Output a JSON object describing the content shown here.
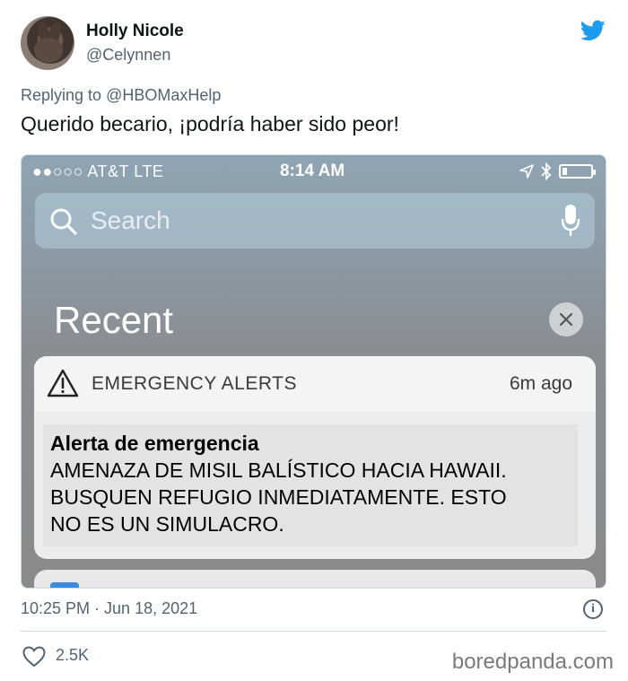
{
  "tweet": {
    "display_name": "Holly Nicole",
    "handle": "@Celynnen",
    "replying_label": "Replying to",
    "replying_to": "@HBOMaxHelp",
    "text": "Querido becario, ¡podría haber sido peor!",
    "timestamp": "10:25 PM · Jun 18, 2021",
    "likes": "2.5K",
    "icons": [
      "twitter-bird-icon",
      "info-icon",
      "heart-icon"
    ]
  },
  "phone": {
    "status": {
      "carrier": "●●○○○ AT&T  LTE",
      "time": "8:14 AM",
      "battery_level": 0.15
    },
    "search": {
      "placeholder": "Search"
    },
    "section_title": "Recent",
    "notification": {
      "app_name": "EMERGENCY ALERTS",
      "time_ago": "6m ago",
      "title": "Alerta de emergencia",
      "lines": [
        "AMENAZA DE MISIL BALÍSTICO HACIA HAWAII.",
        "BUSQUEN REFUGIO INMEDIATAMENTE. ESTO",
        "NO ES UN SIMULACRO."
      ]
    }
  },
  "watermark": "boredpanda.com",
  "colors": {
    "accent": "#1d9bf0",
    "secondary_text": "#536471",
    "primary_text": "#0f1419"
  }
}
